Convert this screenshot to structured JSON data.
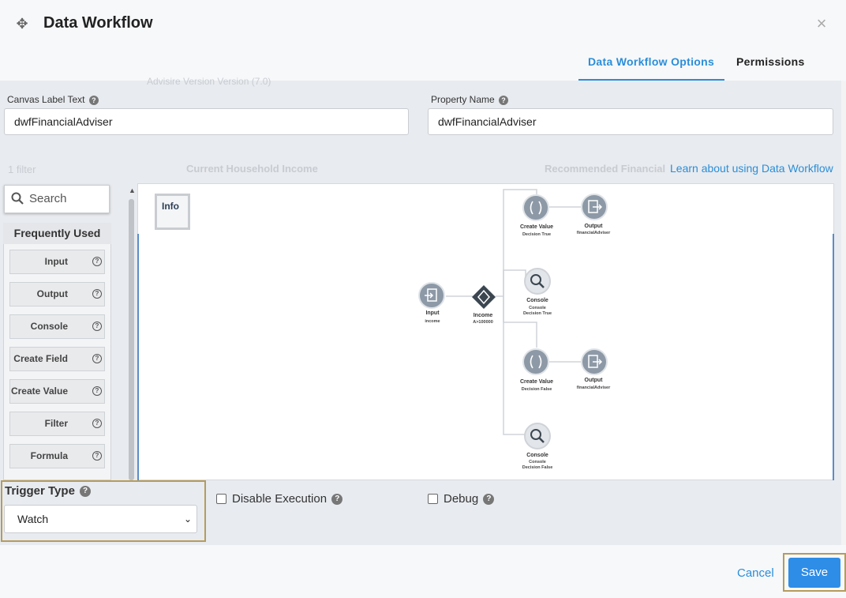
{
  "dialog": {
    "title": "Data Workflow",
    "tabs": [
      {
        "label": "Data Workflow Options",
        "active": true
      },
      {
        "label": "Permissions",
        "active": false
      }
    ]
  },
  "ghost": {
    "version": "Advisire Version   Version (7.0)",
    "filter": "1 filter",
    "income": "Current Household Income",
    "recommended": "Recommended Financial"
  },
  "fields": {
    "canvas_label": {
      "label": "Canvas Label Text",
      "value": "dwfFinancialAdviser"
    },
    "property_name": {
      "label": "Property Name",
      "value": "dwfFinancialAdviser"
    }
  },
  "learn_link": "Learn about using Data Workflow",
  "palette": {
    "search_placeholder": "Search",
    "section": "Frequently Used",
    "items": [
      "Input",
      "Output",
      "Console",
      "Create Field",
      "Create Value",
      "Filter",
      "Formula"
    ]
  },
  "canvas": {
    "info_label": "Info",
    "nodes": {
      "input": {
        "label": "Input",
        "sub": "income"
      },
      "decision": {
        "label": "Income",
        "sub": "A>100000"
      },
      "cv_true": {
        "label": "Create Value",
        "sub": "Decision True"
      },
      "out_true": {
        "label": "Output",
        "sub": "financialAdviser"
      },
      "console_true": {
        "label": "Console",
        "sub": "Console",
        "sub2": "Decision True"
      },
      "cv_false": {
        "label": "Create Value",
        "sub": "Decision False"
      },
      "out_false": {
        "label": "Output",
        "sub": "financialAdviser"
      },
      "console_false": {
        "label": "Console",
        "sub": "Console",
        "sub2": "Decision False"
      }
    }
  },
  "trigger": {
    "label": "Trigger Type",
    "value": "Watch"
  },
  "options": {
    "disable_execution": "Disable Execution",
    "debug": "Debug"
  },
  "footer": {
    "cancel": "Cancel",
    "save": "Save"
  },
  "colors": {
    "accent": "#2a8ed8",
    "save": "#2e8de6",
    "highlight": "#b59c5d",
    "node": "#8d99a6"
  }
}
